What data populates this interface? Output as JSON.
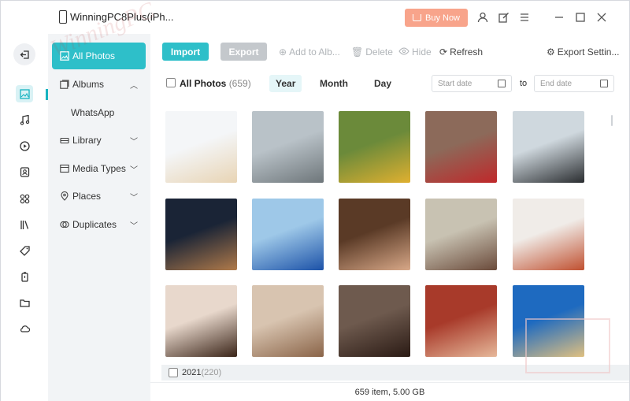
{
  "window": {
    "title": "WinningPC8Plus(iPh...",
    "buy_label": "Buy Now",
    "accent": "#2ebfc9",
    "buy_color": "#f8a48b"
  },
  "watermark": "WinningPC",
  "titlebar_icons": [
    "user-icon",
    "edit-icon",
    "menu-icon",
    "minimize-icon",
    "maximize-icon",
    "close-icon"
  ],
  "rail": [
    "back-icon",
    "photos-icon",
    "music-icon",
    "video-icon",
    "contacts-icon",
    "apps-icon",
    "books-icon",
    "tag-icon",
    "battery-icon",
    "folder-icon",
    "cloud-icon"
  ],
  "sidebar": {
    "all_photos": "All Photos",
    "albums": "Albums",
    "whatsapp": "WhatsApp",
    "library": "Library",
    "media_types": "Media Types",
    "places": "Places",
    "duplicates": "Duplicates"
  },
  "toolbar": {
    "import": "Import",
    "export": "Export",
    "add_to_album": "Add to Alb...",
    "delete": "Delete",
    "hide": "Hide",
    "refresh": "Refresh",
    "export_settings": "Export Settin..."
  },
  "filter": {
    "all_label": "All Photos",
    "all_count": "(659)",
    "year": "Year",
    "month": "Month",
    "day": "Day",
    "start_placeholder": "Start date",
    "to": "to",
    "end_placeholder": "End date"
  },
  "photos": [
    {
      "name": "screenshot-product-photos",
      "colors": [
        "#f4f6f8",
        "#e8d4b4"
      ]
    },
    {
      "name": "white-suv",
      "colors": [
        "#b9c2c8",
        "#6e767a"
      ]
    },
    {
      "name": "blue-car-road",
      "colors": [
        "#6b8a3a",
        "#e0b030"
      ]
    },
    {
      "name": "red-sports-car",
      "colors": [
        "#8c6a5a",
        "#c0282a"
      ]
    },
    {
      "name": "black-jet",
      "colors": [
        "#cfd8de",
        "#2a2d30"
      ]
    },
    {
      "name": "stealth-jets-sunset",
      "colors": [
        "#1a2436",
        "#b07a4a"
      ]
    },
    {
      "name": "blue-sedan-beach",
      "colors": [
        "#9ec8e8",
        "#1c52a8"
      ]
    },
    {
      "name": "brunette-portrait",
      "colors": [
        "#5a3a26",
        "#d8a888"
      ]
    },
    {
      "name": "girl-tree-portrait",
      "colors": [
        "#c8c2b2",
        "#6a4a3a"
      ]
    },
    {
      "name": "redhead-portrait",
      "colors": [
        "#f0ece8",
        "#c05030"
      ]
    },
    {
      "name": "asian-woman-portrait",
      "colors": [
        "#e8d8cc",
        "#3a2418"
      ]
    },
    {
      "name": "blonde-woman-portrait",
      "colors": [
        "#d8c4b0",
        "#8a6448"
      ]
    },
    {
      "name": "dark-hair-girl-portrait",
      "colors": [
        "#6e5a4e",
        "#2a1a14"
      ]
    },
    {
      "name": "woman-lying-portrait",
      "colors": [
        "#a83a2a",
        "#e6b89a"
      ]
    },
    {
      "name": "blonde-blue-pose",
      "colors": [
        "#1e6ac0",
        "#e0c080"
      ]
    }
  ],
  "year_row": {
    "year": "2021",
    "count": "(220)"
  },
  "status": "659 item, 5.00 GB"
}
